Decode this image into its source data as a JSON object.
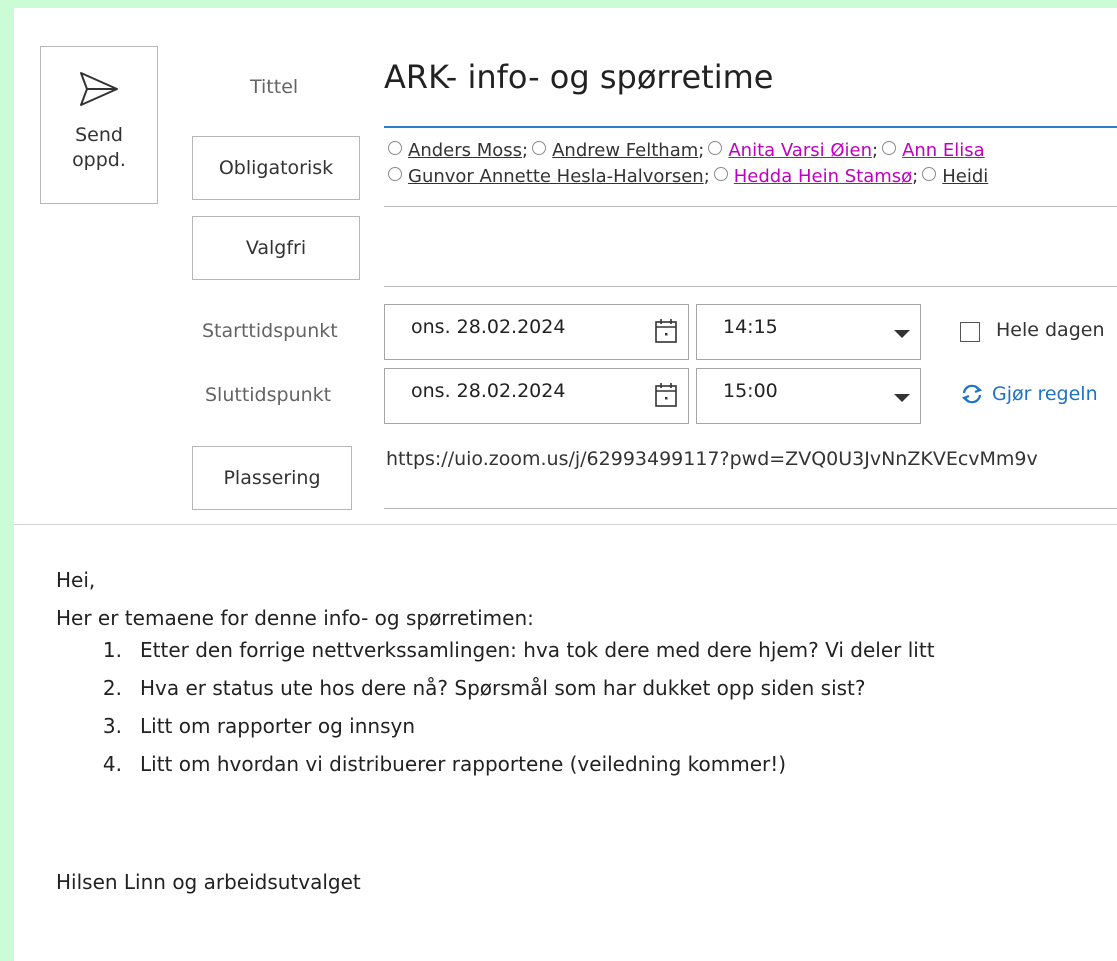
{
  "send_button": {
    "label": "Send\noppd.",
    "icon": "send-icon"
  },
  "labels": {
    "title": "Tittel",
    "required": "Obligatorisk",
    "optional": "Valgfri",
    "start": "Starttidspunkt",
    "end": "Sluttidspunkt",
    "location": "Plassering"
  },
  "meeting": {
    "title": "ARK- info- og spørretime",
    "start_date": "ons. 28.02.2024",
    "start_time": "14:15",
    "end_date": "ons. 28.02.2024",
    "end_time": "15:00",
    "all_day_label": "Hele dagen",
    "all_day_checked": false,
    "recurring_label": "Gjør regeln",
    "location": "https://uio.zoom.us/j/62993499117?pwd=ZVQ0U3JvNnZKVEcvMm9v"
  },
  "recipients": {
    "line1": [
      {
        "name": "Anders Moss",
        "color": "#333333"
      },
      {
        "name": "Andrew Feltham",
        "color": "#333333"
      },
      {
        "name": "Anita Varsi Øien",
        "color": "#c000c0"
      },
      {
        "name": "Ann Elisa",
        "color": "#c000c0"
      }
    ],
    "line2": [
      {
        "name": "Gunvor Annette Hesla-Halvorsen",
        "color": "#333333"
      },
      {
        "name": "Hedda Hein Stamsø",
        "color": "#c000c0"
      },
      {
        "name": "Heidi",
        "color": "#333333"
      }
    ]
  },
  "body": {
    "greeting": "Hei,",
    "intro": "Her er temaene for denne info- og spørretimen:",
    "items": [
      {
        "num": "1.",
        "text": "Etter den forrige nettverkssamlingen: hva tok dere med dere hjem? Vi deler litt"
      },
      {
        "num": "2.",
        "text": "Hva er status ute hos dere nå? Spørsmål som har dukket opp siden sist?"
      },
      {
        "num": "3.",
        "text": "Litt om rapporter og innsyn"
      },
      {
        "num": "4.",
        "text": "Litt om hvordan vi distribuerer rapportene (veiledning kommer!)"
      }
    ],
    "signature": "Hilsen Linn og arbeidsutvalget"
  },
  "colors": {
    "background_frame": "#ccfcd6",
    "accent": "#1e73c4",
    "external_recipient": "#c000c0"
  }
}
